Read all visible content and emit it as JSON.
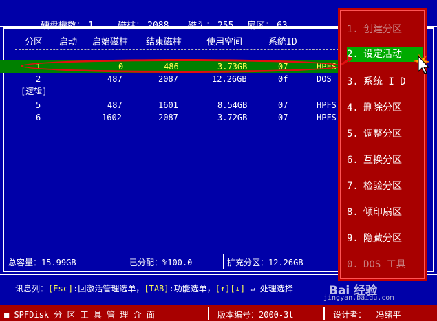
{
  "top": {
    "disk_label": "硬盘機数：",
    "disk_value": "1",
    "cyl_label": "磁柱：",
    "cyl_value": "2088",
    "head_label": "磁头：",
    "head_value": "255",
    "sector_label": "扇区：",
    "sector_value": "63"
  },
  "table": {
    "headers": [
      "分区",
      "启动",
      "启始磁柱",
      "结束磁柱",
      "使用空间",
      "系統ID"
    ],
    "rows": [
      {
        "part": "1",
        "boot": "0",
        "start": "486",
        "end": "3.73GB",
        "size": "07",
        "id": "HPFS",
        "selected": true
      },
      {
        "part": "2",
        "boot": "487",
        "start": "2087",
        "end": "12.26GB",
        "size": "0f",
        "id": "DOS"
      },
      {
        "part": "5",
        "boot": "487",
        "start": "1601",
        "end": "8.54GB",
        "size": "07",
        "id": "HPFS"
      },
      {
        "part": "6",
        "boot": "1602",
        "start": "2087",
        "end": "3.72GB",
        "size": "07",
        "id": "HPFS"
      }
    ],
    "logical_label": "[逻辑]"
  },
  "stats": {
    "total": "总容量：15.99GB",
    "allocated": "已分配：%100.0",
    "extended": "扩充分区：12.26GB"
  },
  "hint": {
    "prefix": "讯息列：",
    "esc_key": "[Esc]",
    "esc_text": ":回激活管理选单，",
    "tab_key": "[TAB]",
    "tab_text": ":功能选单，",
    "arrow_key": "[↑][↓]",
    "enter_text": " ↵ 处理选择"
  },
  "status": {
    "app": "■ SPFDisk 分 区 工 具 管 理 介 面",
    "version": "版本编号：2000-3t",
    "designer": "设计者：  冯绪平"
  },
  "menu": {
    "items": [
      {
        "n": "1.",
        "label": "创建分区",
        "state": "dim"
      },
      {
        "n": "2.",
        "label": "设定活动",
        "state": "hl"
      },
      {
        "n": "3.",
        "label": "系统 I D",
        "state": ""
      },
      {
        "n": "4.",
        "label": "删除分区",
        "state": ""
      },
      {
        "n": "5.",
        "label": "调整分区",
        "state": ""
      },
      {
        "n": "6.",
        "label": "互换分区",
        "state": ""
      },
      {
        "n": "7.",
        "label": "检验分区",
        "state": ""
      },
      {
        "n": "8.",
        "label": "倾印扇区",
        "state": ""
      },
      {
        "n": "9.",
        "label": "隐藏分区",
        "state": ""
      },
      {
        "n": "0.",
        "label": "DOS 工具",
        "state": "dim"
      }
    ]
  },
  "watermark": {
    "logo": "Bai 经验",
    "url": "jingyan.baidu.com"
  },
  "colors": {
    "background": "#0000a8",
    "selected_row": "#008000",
    "menu_bg": "#a80000",
    "highlight": "#00aa00",
    "annotation": "#e01010"
  }
}
